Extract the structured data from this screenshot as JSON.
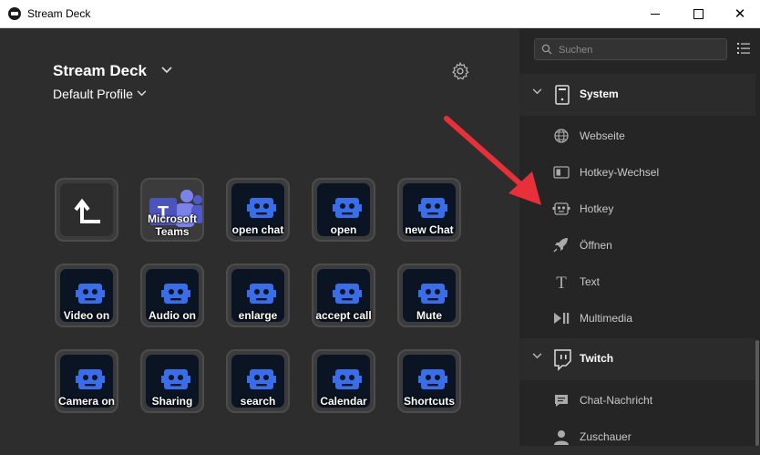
{
  "window": {
    "title": "Stream Deck"
  },
  "header": {
    "title": "Stream Deck",
    "profile": "Default Profile"
  },
  "keys": [
    {
      "label": "",
      "type": "back"
    },
    {
      "label": "Microsoft Teams",
      "type": "teams"
    },
    {
      "label": "open chat",
      "type": "hotkey"
    },
    {
      "label": "open",
      "type": "hotkey"
    },
    {
      "label": "new Chat",
      "type": "hotkey"
    },
    {
      "label": "Video on",
      "type": "hotkey"
    },
    {
      "label": "Audio on",
      "type": "hotkey"
    },
    {
      "label": "enlarge",
      "type": "hotkey"
    },
    {
      "label": "accept call",
      "type": "hotkey"
    },
    {
      "label": "Mute",
      "type": "hotkey"
    },
    {
      "label": "Camera on",
      "type": "hotkey"
    },
    {
      "label": "Sharing",
      "type": "hotkey"
    },
    {
      "label": "search",
      "type": "hotkey"
    },
    {
      "label": "Calendar",
      "type": "hotkey"
    },
    {
      "label": "Shortcuts",
      "type": "hotkey"
    }
  ],
  "sidebar": {
    "search_placeholder": "Suchen",
    "categories": [
      {
        "label": "System",
        "icon": "system-icon",
        "actions": [
          {
            "label": "Webseite",
            "icon": "globe-icon"
          },
          {
            "label": "Hotkey-Wechsel",
            "icon": "hotkey-switch-icon"
          },
          {
            "label": "Hotkey",
            "icon": "robot-icon"
          },
          {
            "label": "Öffnen",
            "icon": "rocket-icon"
          },
          {
            "label": "Text",
            "icon": "text-icon"
          },
          {
            "label": "Multimedia",
            "icon": "play-pause-icon"
          }
        ]
      },
      {
        "label": "Twitch",
        "icon": "twitch-icon",
        "actions": [
          {
            "label": "Chat-Nachricht",
            "icon": "chat-icon"
          },
          {
            "label": "Zuschauer",
            "icon": "user-icon"
          }
        ]
      }
    ]
  },
  "colors": {
    "accent": "#3a6ee8",
    "annotation_arrow": "#e8303a"
  }
}
